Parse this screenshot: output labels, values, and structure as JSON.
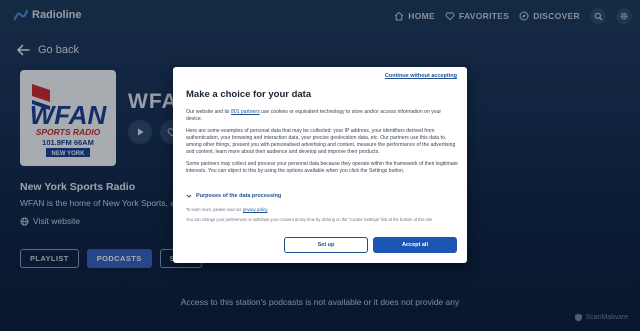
{
  "header": {
    "brand": "Radioline",
    "nav": [
      {
        "label": "HOME",
        "icon": "home-icon"
      },
      {
        "label": "FAVORITES",
        "icon": "heart-icon"
      },
      {
        "label": "DISCOVER",
        "icon": "compass-icon"
      }
    ],
    "search_icon": "search-icon",
    "settings_icon": "gear-icon"
  },
  "content": {
    "go_back": "Go back",
    "title": "WFAN",
    "logo": {
      "main": "WFAN",
      "sub": "SPORTS RADIO",
      "freq": "101.9FM 66AM",
      "city": "NEW YORK"
    },
    "station_name": "New York Sports Radio",
    "description": "WFAN is the home of New York Sports, and",
    "visit": "Visit website",
    "tabs": [
      "PLAYLIST",
      "PODCASTS",
      "SCHE"
    ],
    "active_tab": "PODCASTS",
    "notice": "Access to this station's podcasts is not available or it does not provide any"
  },
  "modal": {
    "continue_link": "Continue without accepting",
    "title": "Make a choice for your data",
    "intro_before": "Our website and its ",
    "intro_link": "801 partners",
    "intro_after": " use cookies or equivalent technology to store and/or access information on your device.",
    "para2": "Here are some examples of personal data that may be collected: your IP address, your identifiers derived from authentication, your browsing and interaction data, your precise geolocation data, etc. Our partners use this data to, among other things, present you with personalised advertising and content, measure the performance of the advertising and content, learn more about their audience and develop and improve their products.",
    "para3": "Some partners may collect and process your personal data because they operate within the framework of their legitimate interests. You can object to this by using the options available when you click the Settings button.",
    "purposes": "Purposes of the data processing",
    "fine1_before": "To learn more, please read our ",
    "fine1_link": "privacy policy",
    "fine2": "You can change your preferences or withdraw your consent at any time by clicking on the \"Cookie Settings\" link at the bottom of this site.",
    "setup_button": "Set up",
    "accept_button": "Accept all"
  },
  "watermark": "ScanMalware",
  "colors": {
    "accent": "#1d55b4",
    "background": "#0e2440",
    "active_tab": "#3a64c4",
    "logo_red": "#d42a2a",
    "logo_blue": "#1a3f95"
  }
}
